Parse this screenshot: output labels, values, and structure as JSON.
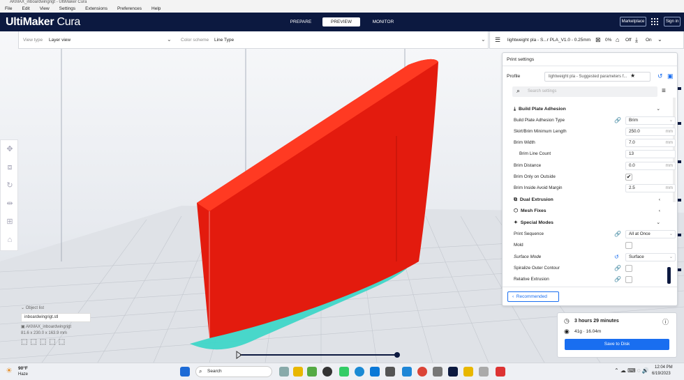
{
  "window": {
    "title": "AKMAX_inboardwingrigt - UltiMaker Cura"
  },
  "menu": [
    "File",
    "Edit",
    "View",
    "Settings",
    "Extensions",
    "Preferences",
    "Help"
  ],
  "header": {
    "logo_bold": "UltiMaker",
    "logo_light": " Cura",
    "stages": {
      "prepare": "PREPARE",
      "preview": "PREVIEW",
      "monitor": "MONITOR"
    },
    "marketplace": "Marketplace",
    "signin": "Sign in"
  },
  "viewbar": {
    "view_type_label": "View type",
    "view_type_value": "Layer view",
    "color_scheme_label": "Color scheme",
    "color_scheme_value": "Line Type"
  },
  "printbar": {
    "profile": "lightweight pla - S...r PLA_V1.0 - 0.25mm",
    "infill": "0%",
    "support": "Off",
    "adhesion": "On"
  },
  "settings": {
    "title": "Print settings",
    "profile_label": "Profile",
    "profile_value": "lightweight pla - Suggested parameters f...",
    "search_placeholder": "Search settings",
    "categories": {
      "build_plate": "Build Plate Adhesion",
      "dual": "Dual Extrusion",
      "mesh": "Mesh Fixes",
      "special": "Special Modes"
    },
    "rows": {
      "adhesion_type": {
        "label": "Build Plate Adhesion Type",
        "value": "Brim"
      },
      "skirt_min": {
        "label": "Skirt/Brim Minimum Length",
        "value": "250.0",
        "unit": "mm"
      },
      "brim_width": {
        "label": "Brim Width",
        "value": "7.0",
        "unit": "mm"
      },
      "brim_line_count": {
        "label": "Brim Line Count",
        "value": "13"
      },
      "brim_distance": {
        "label": "Brim Distance",
        "value": "0.0",
        "unit": "mm"
      },
      "brim_outside": {
        "label": "Brim Only on Outside"
      },
      "brim_avoid": {
        "label": "Brim Inside Avoid Margin",
        "value": "2.5",
        "unit": "mm"
      },
      "print_seq": {
        "label": "Print Sequence",
        "value": "All at Once"
      },
      "mold": {
        "label": "Mold"
      },
      "surface_mode": {
        "label": "Surface Mode",
        "value": "Surface"
      },
      "spiralize": {
        "label": "Spiralize Outer Contour"
      },
      "relative": {
        "label": "Relative Extrusion"
      }
    },
    "recommended": "Recommended"
  },
  "print": {
    "time": "3 hours 29 minutes",
    "material": "41g · 16.04m",
    "save": "Save to Disk"
  },
  "objects": {
    "header": "Object list",
    "file": "inboardwingrigt.stl",
    "name": "AKMAX_inboardwingrigt",
    "dims": "81.6 x 230.0 x 163.9 mm"
  },
  "taskbar": {
    "temp": "90°F",
    "weather": "Haze",
    "search": "Search",
    "time": "12:04 PM",
    "date": "6/19/2023"
  },
  "colors": {
    "model": "#e31b0e",
    "brim": "#3fd6c8",
    "accent": "#196ef0",
    "header": "#0c1940"
  }
}
